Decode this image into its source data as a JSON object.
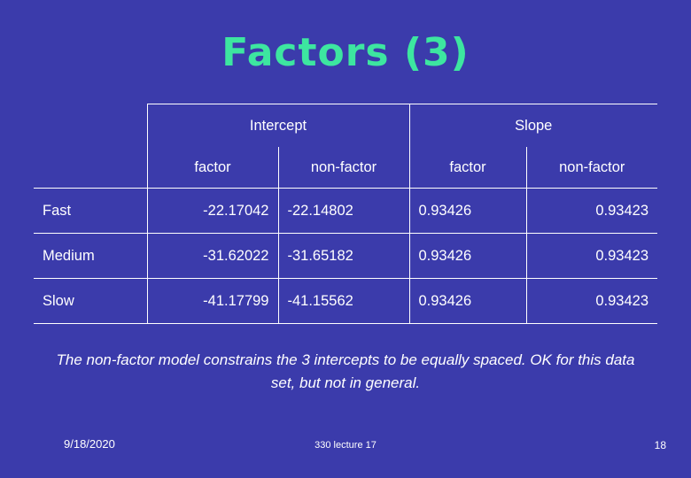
{
  "slide": {
    "title": "Factors (3)",
    "caption": "The non-factor model constrains the 3 intercepts to be equally spaced. OK for this data set, but not in general.",
    "footer": {
      "date": "9/18/2020",
      "center": "330 lecture 17",
      "page": "18"
    },
    "colors": {
      "background": "#3b3bab",
      "title": "#3de6a0",
      "text": "#ffffff"
    }
  },
  "table": {
    "group_headers": [
      "",
      "Intercept",
      "Slope"
    ],
    "sub_headers": [
      "",
      "factor",
      "non-factor",
      "factor",
      "non-factor"
    ],
    "rows": [
      {
        "label": "Fast",
        "intercept_factor": "-22.17042",
        "intercept_nonfactor": "-22.14802",
        "slope_factor": "0.93426",
        "slope_nonfactor": "0.93423"
      },
      {
        "label": "Medium",
        "intercept_factor": "-31.62022",
        "intercept_nonfactor": "-31.65182",
        "slope_factor": "0.93426",
        "slope_nonfactor": "0.93423"
      },
      {
        "label": "Slow",
        "intercept_factor": "-41.17799",
        "intercept_nonfactor": "-41.15562",
        "slope_factor": "0.93426",
        "slope_nonfactor": "0.93423"
      }
    ]
  }
}
